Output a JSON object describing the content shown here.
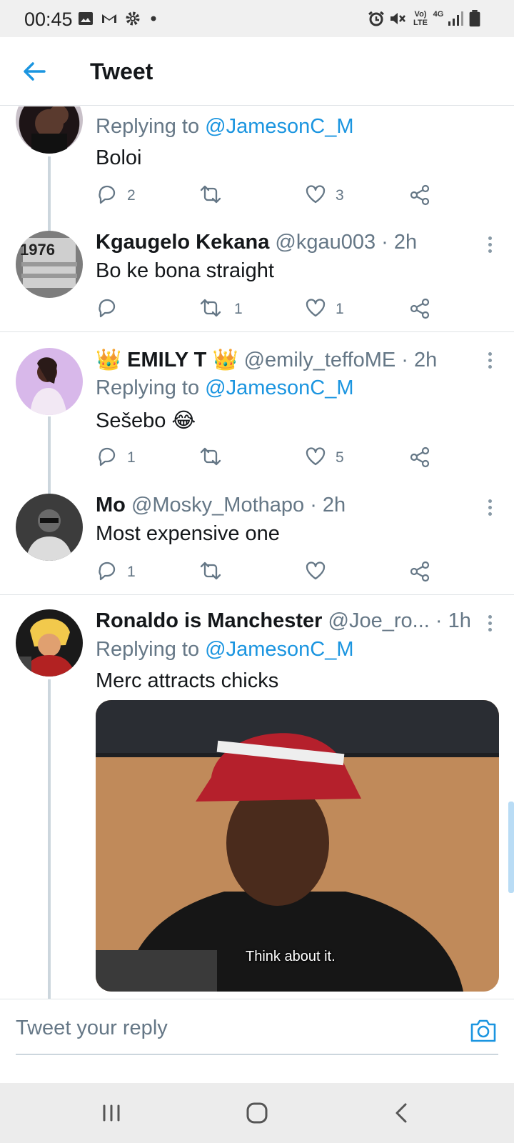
{
  "status_bar": {
    "time": "00:45",
    "icons": [
      "image-icon",
      "gmail-icon",
      "gear-icon",
      "dot-icon",
      "alarm-icon",
      "mute-icon",
      "volte-icon",
      "4g-icon",
      "signal-icon",
      "battery-icon"
    ],
    "volte_top": "Vo)",
    "volte_bottom": "LTE",
    "network": "4G"
  },
  "header": {
    "title": "Tweet",
    "back_icon": "arrow-left-icon"
  },
  "colors": {
    "accent": "#1b95e0",
    "text": "#14171a",
    "muted": "#657786",
    "divider": "#dfe3e6"
  },
  "tweets": [
    {
      "replying_prefix": "Replying to ",
      "replying_handle": "@JamesonC_M",
      "text": "Boloi",
      "replies": "2",
      "retweets": "",
      "likes": "3"
    },
    {
      "name": "Kgaugelo Kekana",
      "meta": "@kgau003 · 2h",
      "text": "Bo ke bona straight",
      "replies": "",
      "retweets": "1",
      "likes": "1"
    },
    {
      "crown_left": "👑",
      "name": "EMILY T",
      "crown_right": "👑",
      "meta": "@emily_teffoME · 2h",
      "replying_prefix": "Replying to ",
      "replying_handle": "@JamesonC_M",
      "text": "Sešebo 😂",
      "replies": "1",
      "retweets": "",
      "likes": "5"
    },
    {
      "name": "Mo",
      "meta": "@Mosky_Mothapo · 2h",
      "text": "Most expensive one",
      "replies": "1",
      "retweets": "",
      "likes": ""
    },
    {
      "name": "Ronaldo is Manchester",
      "meta": "@Joe_ro... · 1h",
      "replying_prefix": "Replying to ",
      "replying_handle": "@JamesonC_M",
      "text": "Merc attracts chicks",
      "media_caption": "Think about it."
    }
  ],
  "reply_bar": {
    "placeholder": "Tweet your reply",
    "camera_icon": "camera-icon"
  },
  "nav_bar": [
    "recent-apps-icon",
    "home-icon",
    "back-icon"
  ]
}
